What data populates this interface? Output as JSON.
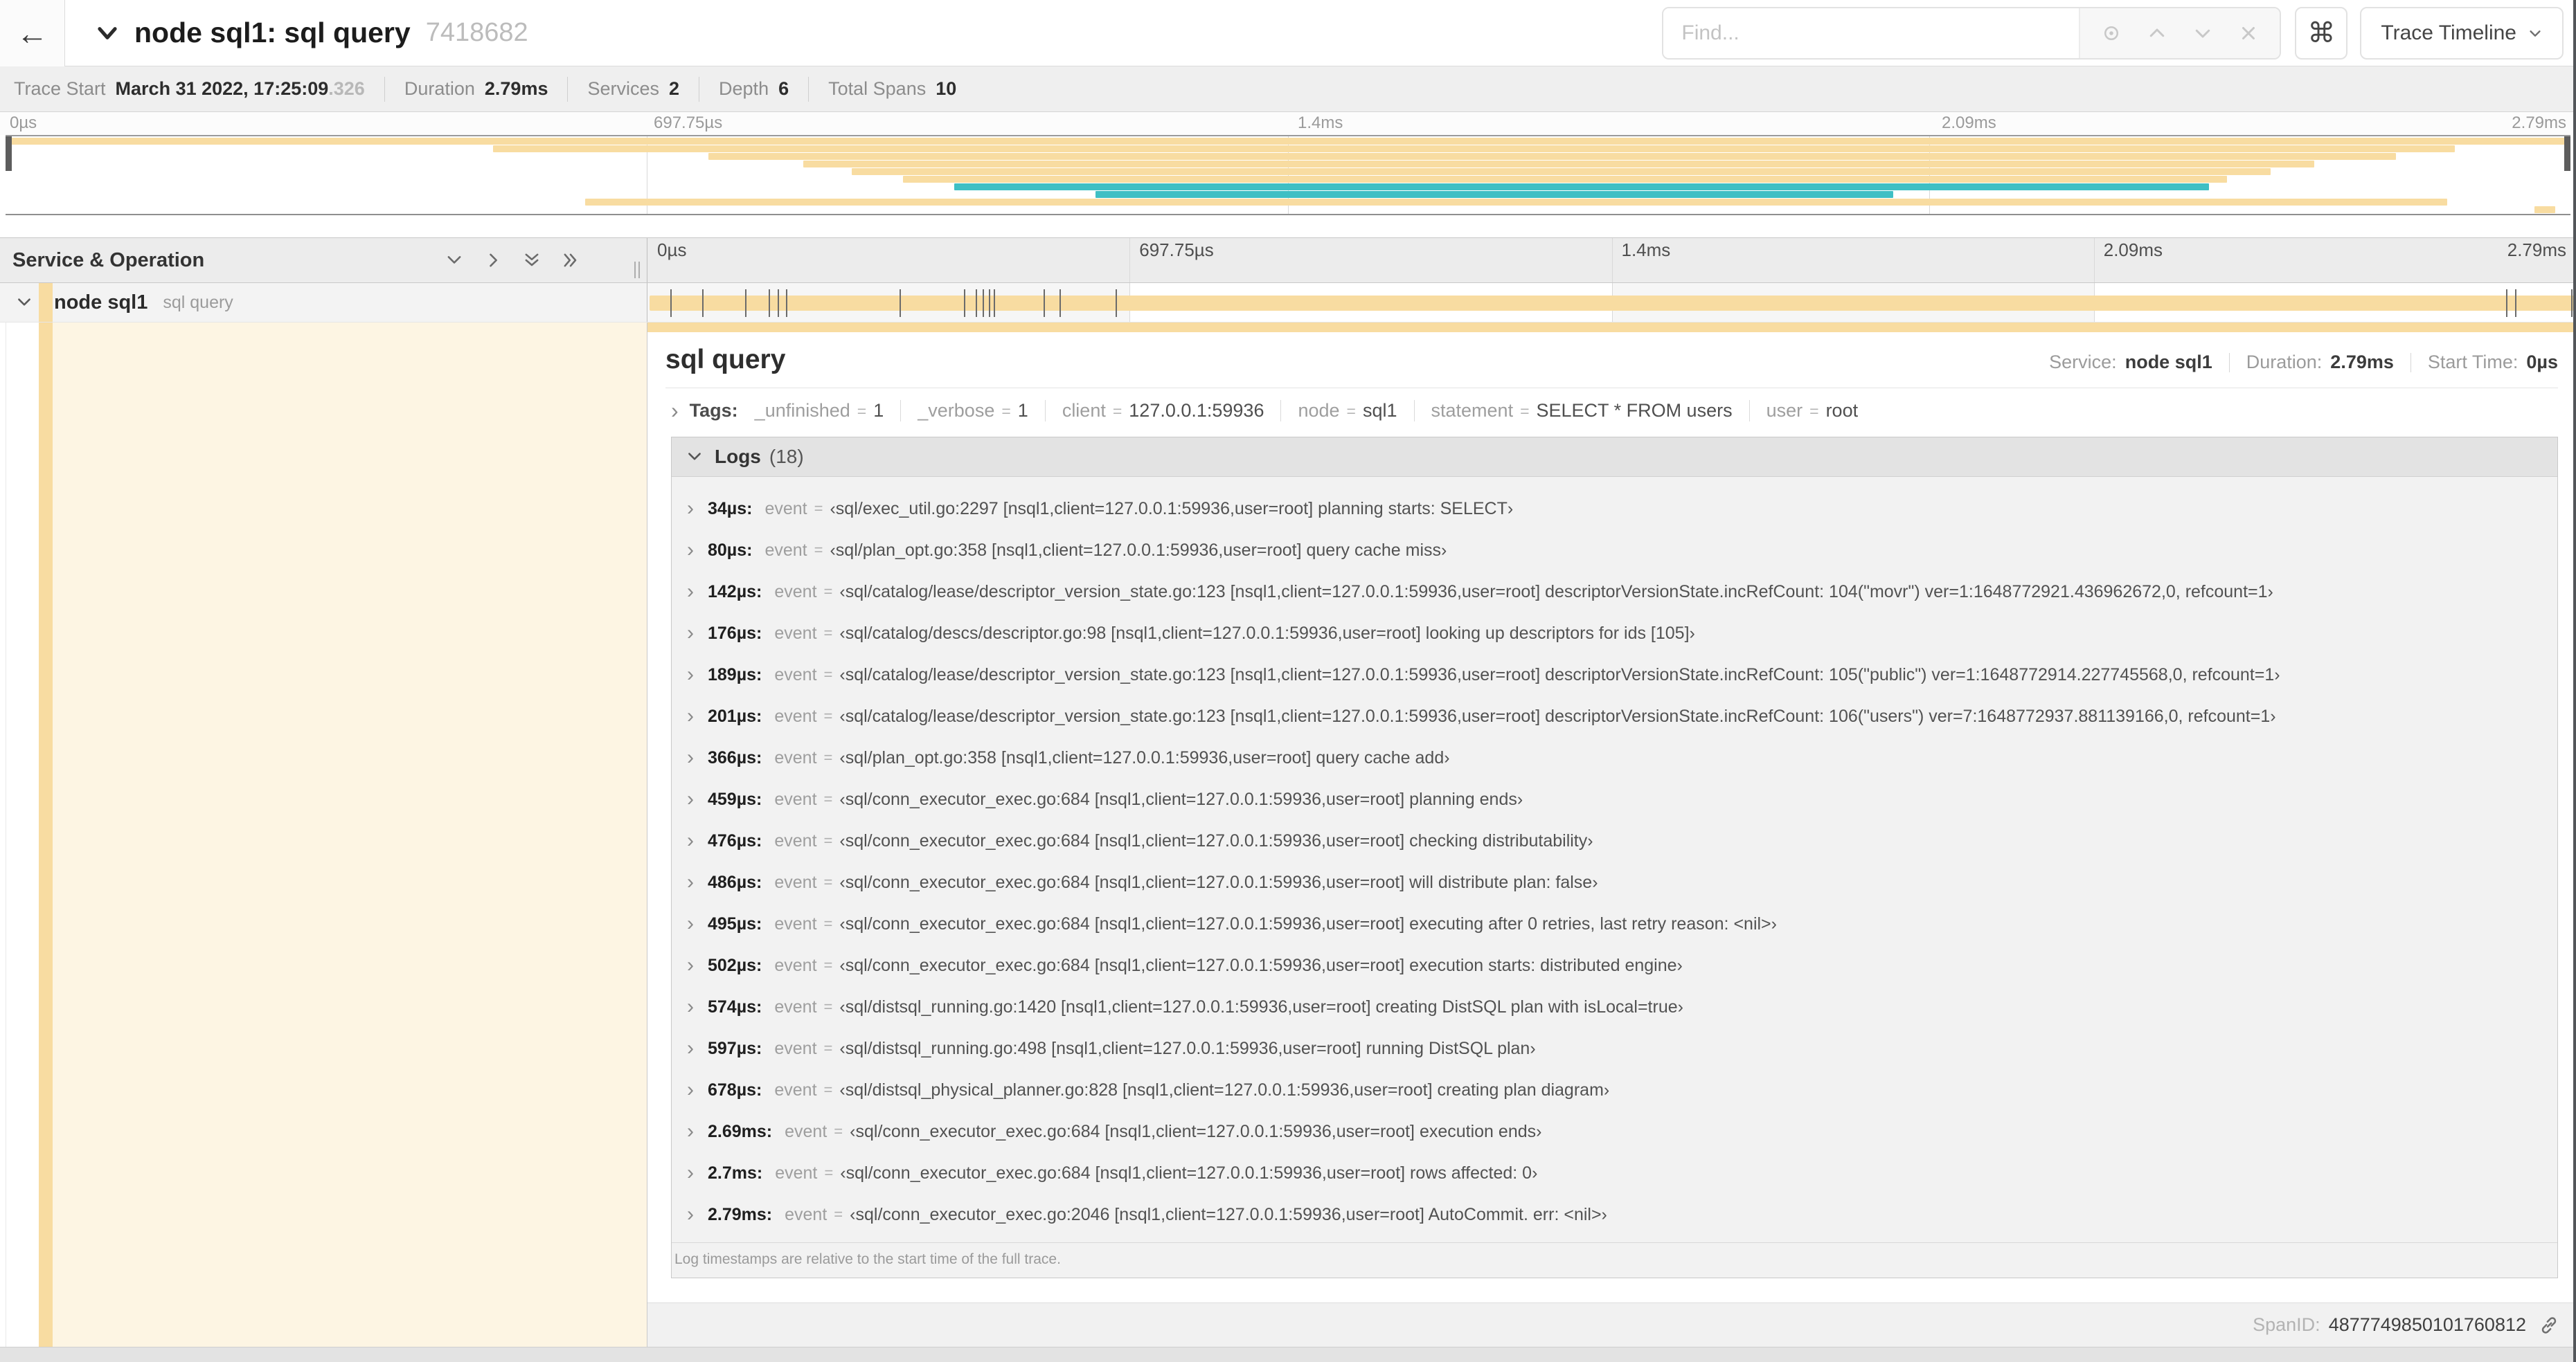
{
  "colors": {
    "span_primary": "#F8DCA1",
    "span_secondary": "#3EBFC4",
    "detail_tint": "#FDF5E3"
  },
  "header": {
    "back_icon": "←",
    "title": "node sql1: sql query",
    "trace_id": "7418682",
    "find_placeholder": "Find...",
    "shortcut_label": "⌘",
    "view_dropdown_label": "Trace Timeline"
  },
  "trace_info": {
    "items": [
      {
        "label": "Trace Start",
        "value": "March 31 2022, 17:25:09",
        "suffix": ".326"
      },
      {
        "label": "Duration",
        "value": "2.79ms"
      },
      {
        "label": "Services",
        "value": "2"
      },
      {
        "label": "Depth",
        "value": "6"
      },
      {
        "label": "Total Spans",
        "value": "10"
      }
    ]
  },
  "minimap": {
    "ticks": [
      "0µs",
      "697.75µs",
      "1.4ms",
      "2.09ms",
      "2.79ms"
    ],
    "bars": [
      {
        "s": 0.0,
        "e": 1.0,
        "c": "p"
      },
      {
        "s": 0.19,
        "e": 0.955,
        "c": "p"
      },
      {
        "s": 0.274,
        "e": 0.932,
        "c": "p"
      },
      {
        "s": 0.311,
        "e": 0.9,
        "c": "p"
      },
      {
        "s": 0.33,
        "e": 0.883,
        "c": "p"
      },
      {
        "s": 0.35,
        "e": 0.866,
        "c": "p"
      },
      {
        "s": 0.37,
        "e": 0.859,
        "c": "s"
      },
      {
        "s": 0.425,
        "e": 0.736,
        "c": "s"
      },
      {
        "s": 0.226,
        "e": 0.952,
        "c": "p"
      },
      {
        "s": 0.986,
        "e": 0.994,
        "c": "p"
      }
    ]
  },
  "timeline": {
    "left_header": "Service & Operation",
    "ticks": [
      "0µs",
      "697.75µs",
      "1.4ms",
      "2.09ms",
      "2.79ms"
    ],
    "row": {
      "service": "node sql1",
      "operation": "sql query",
      "tick_fractions": [
        0.0122,
        0.0287,
        0.0509,
        0.0631,
        0.0677,
        0.072,
        0.1312,
        0.1645,
        0.1706,
        0.1742,
        0.1774,
        0.1799,
        0.2057,
        0.214,
        0.243,
        0.9642,
        0.9688,
        0.998
      ]
    }
  },
  "detail": {
    "title": "sql query",
    "meta": [
      {
        "label": "Service:",
        "value": "node sql1"
      },
      {
        "label": "Duration:",
        "value": "2.79ms"
      },
      {
        "label": "Start Time:",
        "value": "0µs"
      }
    ],
    "tags_label": "Tags:",
    "tags": [
      {
        "key": "_unfinished",
        "value": "1"
      },
      {
        "key": "_verbose",
        "value": "1"
      },
      {
        "key": "client",
        "value": "127.0.0.1:59936"
      },
      {
        "key": "node",
        "value": "sql1"
      },
      {
        "key": "statement",
        "value": "SELECT * FROM users"
      },
      {
        "key": "user",
        "value": "root"
      }
    ],
    "logs_label": "Logs",
    "logs_count": "(18)",
    "log_key": "event",
    "logs": [
      {
        "time": "34µs:",
        "value": "‹sql/exec_util.go:2297 [nsql1,client=127.0.0.1:59936,user=root] planning starts: SELECT›"
      },
      {
        "time": "80µs:",
        "value": "‹sql/plan_opt.go:358 [nsql1,client=127.0.0.1:59936,user=root] query cache miss›"
      },
      {
        "time": "142µs:",
        "value": "‹sql/catalog/lease/descriptor_version_state.go:123 [nsql1,client=127.0.0.1:59936,user=root] descriptorVersionState.incRefCount: 104(\"movr\") ver=1:1648772921.436962672,0, refcount=1›"
      },
      {
        "time": "176µs:",
        "value": "‹sql/catalog/descs/descriptor.go:98 [nsql1,client=127.0.0.1:59936,user=root] looking up descriptors for ids [105]›"
      },
      {
        "time": "189µs:",
        "value": "‹sql/catalog/lease/descriptor_version_state.go:123 [nsql1,client=127.0.0.1:59936,user=root] descriptorVersionState.incRefCount: 105(\"public\") ver=1:1648772914.227745568,0, refcount=1›"
      },
      {
        "time": "201µs:",
        "value": "‹sql/catalog/lease/descriptor_version_state.go:123 [nsql1,client=127.0.0.1:59936,user=root] descriptorVersionState.incRefCount: 106(\"users\") ver=7:1648772937.881139166,0, refcount=1›"
      },
      {
        "time": "366µs:",
        "value": "‹sql/plan_opt.go:358 [nsql1,client=127.0.0.1:59936,user=root] query cache add›"
      },
      {
        "time": "459µs:",
        "value": "‹sql/conn_executor_exec.go:684 [nsql1,client=127.0.0.1:59936,user=root] planning ends›"
      },
      {
        "time": "476µs:",
        "value": "‹sql/conn_executor_exec.go:684 [nsql1,client=127.0.0.1:59936,user=root] checking distributability›"
      },
      {
        "time": "486µs:",
        "value": "‹sql/conn_executor_exec.go:684 [nsql1,client=127.0.0.1:59936,user=root] will distribute plan: false›"
      },
      {
        "time": "495µs:",
        "value": "‹sql/conn_executor_exec.go:684 [nsql1,client=127.0.0.1:59936,user=root] executing after 0 retries, last retry reason: <nil>›"
      },
      {
        "time": "502µs:",
        "value": "‹sql/conn_executor_exec.go:684 [nsql1,client=127.0.0.1:59936,user=root] execution starts: distributed engine›"
      },
      {
        "time": "574µs:",
        "value": "‹sql/distsql_running.go:1420 [nsql1,client=127.0.0.1:59936,user=root] creating DistSQL plan with isLocal=true›"
      },
      {
        "time": "597µs:",
        "value": "‹sql/distsql_running.go:498 [nsql1,client=127.0.0.1:59936,user=root] running DistSQL plan›"
      },
      {
        "time": "678µs:",
        "value": "‹sql/distsql_physical_planner.go:828 [nsql1,client=127.0.0.1:59936,user=root] creating plan diagram›"
      },
      {
        "time": "2.69ms:",
        "value": "‹sql/conn_executor_exec.go:684 [nsql1,client=127.0.0.1:59936,user=root] execution ends›"
      },
      {
        "time": "2.7ms:",
        "value": "‹sql/conn_executor_exec.go:684 [nsql1,client=127.0.0.1:59936,user=root] rows affected: 0›"
      },
      {
        "time": "2.79ms:",
        "value": "‹sql/conn_executor_exec.go:2046 [nsql1,client=127.0.0.1:59936,user=root] AutoCommit. err: <nil>›"
      }
    ],
    "logs_footer": "Log timestamps are relative to the start time of the full trace.",
    "spanid_label": "SpanID:",
    "spanid": "4877749850101760812"
  }
}
